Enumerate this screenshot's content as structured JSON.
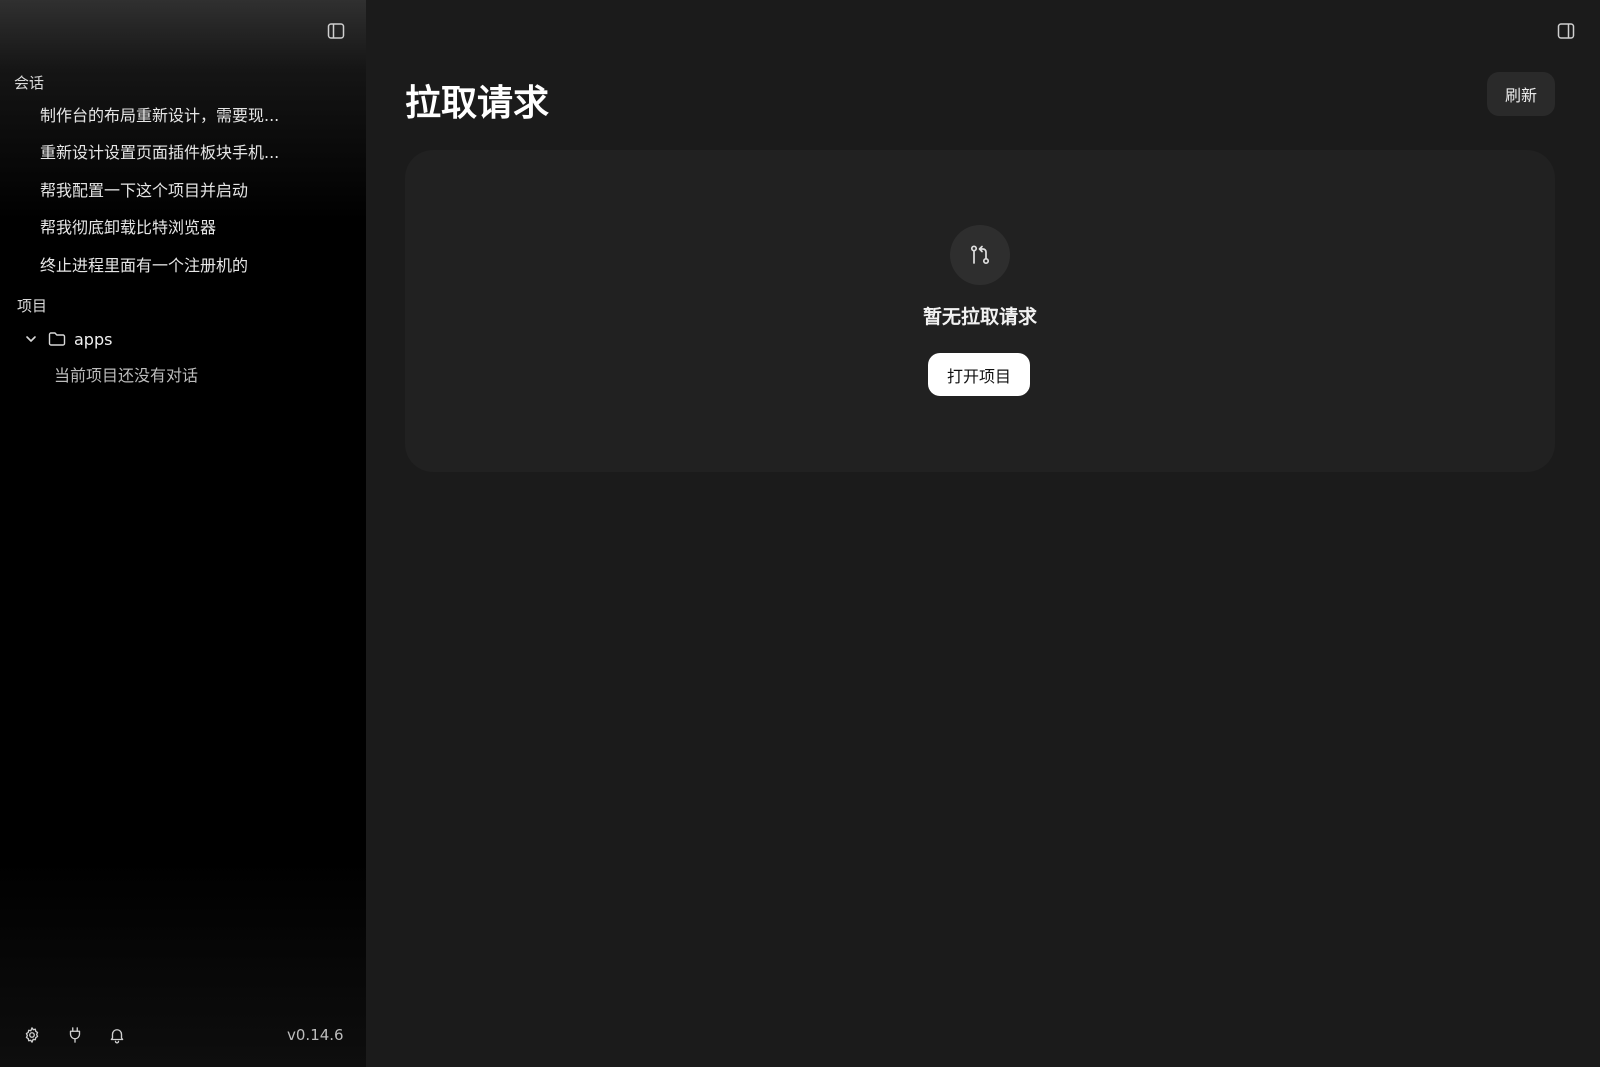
{
  "sidebar": {
    "conversations_label": "会话",
    "conversations": [
      "制作台的布局重新设计，需要现...",
      "重新设计设置页面插件板块手机...",
      "帮我配置一下这个项目并启动",
      "帮我彻底卸载比特浏览器",
      "终止进程里面有一个注册机的"
    ],
    "projects_label": "项目",
    "project": {
      "name": "apps",
      "empty_text": "当前项目还没有对话"
    },
    "version": "v0.14.6"
  },
  "main": {
    "title": "拉取请求",
    "refresh_label": "刷新",
    "empty": {
      "title": "暂无拉取请求",
      "action_label": "打开项目"
    }
  },
  "icons": [
    "sidebar-toggle-icon",
    "panel-toggle-icon",
    "chevron-down-icon",
    "folder-icon",
    "settings-icon",
    "plug-icon",
    "bell-icon",
    "pull-request-icon"
  ]
}
